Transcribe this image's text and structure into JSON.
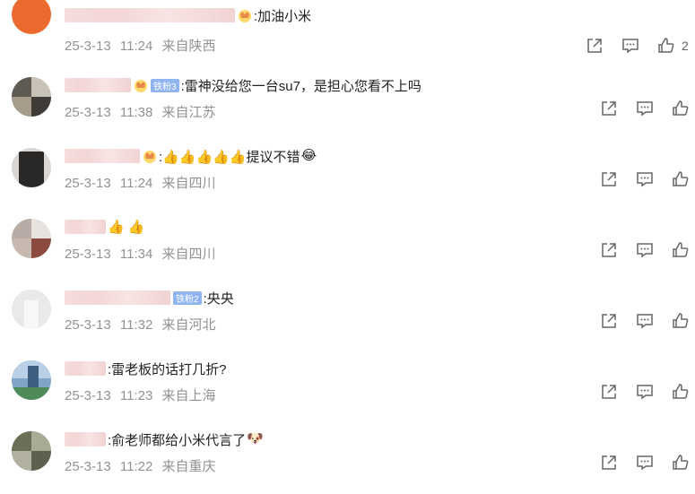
{
  "comments": [
    {
      "text": ":加油小米",
      "emoji": "",
      "date": "25-3-13",
      "time": "11:24",
      "location": "来自陕西",
      "likes": "2",
      "badge": ""
    },
    {
      "text": ":雷神没给您一台su7，是担心您看不上吗",
      "emoji": "",
      "date": "25-3-13",
      "time": "11:38",
      "location": "来自江苏",
      "likes": "",
      "badge": "铁粉3"
    },
    {
      "text": ":👍👍👍👍👍提议不错",
      "emoji": "😂",
      "date": "25-3-13",
      "time": "11:24",
      "location": "来自四川",
      "likes": "",
      "badge": ""
    },
    {
      "text": "👍 👍",
      "emoji": "",
      "date": "25-3-13",
      "time": "11:34",
      "location": "来自四川",
      "likes": "",
      "badge": ""
    },
    {
      "text": ":央央",
      "emoji": "",
      "date": "25-3-13",
      "time": "11:32",
      "location": "来自河北",
      "likes": "",
      "badge": "铁粉2"
    },
    {
      "text": ":雷老板的话打几折?",
      "emoji": "",
      "date": "25-3-13",
      "time": "11:23",
      "location": "来自上海",
      "likes": "",
      "badge": ""
    },
    {
      "text": ":俞老师都给小米代言了",
      "emoji": "🐶",
      "date": "25-3-13",
      "time": "11:22",
      "location": "来自重庆",
      "likes": "",
      "badge": ""
    }
  ],
  "icons": {
    "share": "share-icon",
    "reply": "comment-icon",
    "like": "thumbs-up-icon",
    "crown": "crown-icon",
    "badge": "fan-badge-icon"
  },
  "colors": {
    "meta": "#929292",
    "badge": "#8fb4ef",
    "text": "#222222"
  }
}
